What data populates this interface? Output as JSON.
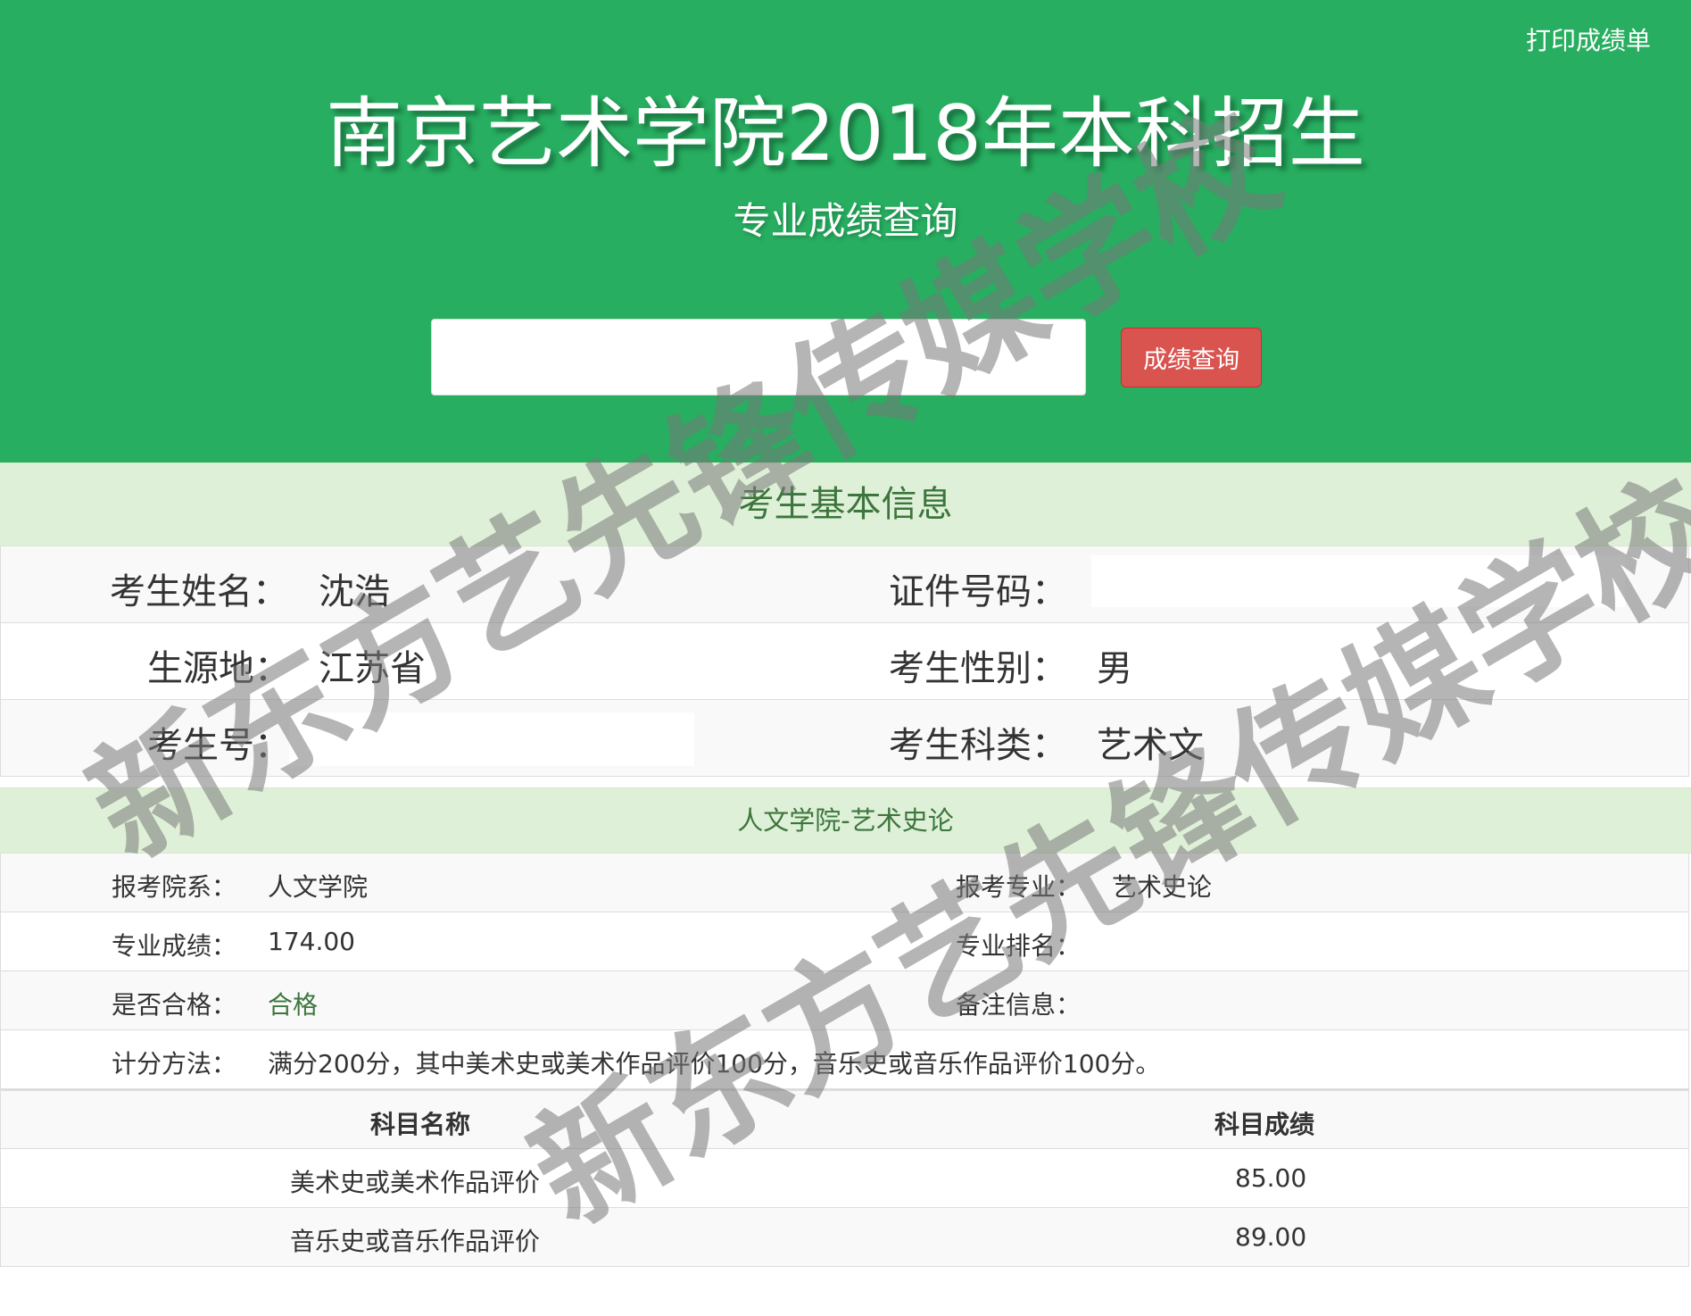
{
  "header": {
    "print_label": "打印成绩单",
    "title": "南京艺术学院2018年本科招生",
    "subtitle": "专业成绩查询",
    "search_value": "",
    "search_button": "成绩查询"
  },
  "basic_info": {
    "heading": "考生基本信息",
    "name_label": "考生姓名：",
    "name_value": "沈浩",
    "id_label": "证件号码：",
    "origin_label": "生源地：",
    "origin_value": "江苏省",
    "gender_label": "考生性别：",
    "gender_value": "男",
    "exam_no_label": "考生号：",
    "category_label": "考生科类：",
    "category_value": "艺术文"
  },
  "major": {
    "heading": "人文学院-艺术史论",
    "dept_label": "报考院系：",
    "dept_value": "人文学院",
    "major_label": "报考专业：",
    "major_value": "艺术史论",
    "score_label": "专业成绩：",
    "score_value": "174.00",
    "rank_label": "专业排名：",
    "rank_value": "",
    "pass_label": "是否合格：",
    "pass_value": "合格",
    "note_label": "备注信息：",
    "note_value": "",
    "method_label": "计分方法：",
    "method_value": "满分200分，其中美术史或美术作品评价100分，音乐史或音乐作品评价100分。"
  },
  "subjects": {
    "headers": [
      "科目名称",
      "科目成绩"
    ],
    "rows": [
      {
        "name": "美术史或美术作品评价",
        "score": "85.00"
      },
      {
        "name": "音乐史或音乐作品评价",
        "score": "89.00"
      }
    ]
  },
  "watermark": {
    "text": "新东方艺先锋传媒学校"
  },
  "colors": {
    "header_green": "#27ae60",
    "section_bg": "#dff0d8",
    "section_text": "#3c763d",
    "button_red": "#d9534f"
  }
}
